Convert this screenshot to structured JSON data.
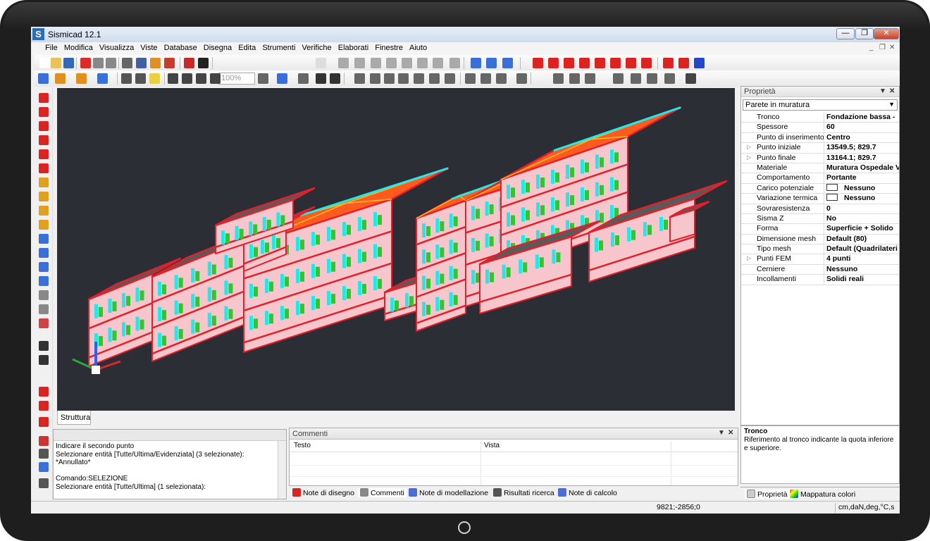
{
  "app": {
    "title": "Sismicad 12.1",
    "logo": "S",
    "win_controls": [
      "minimize-icon",
      "restore-icon",
      "close-icon"
    ]
  },
  "menu": [
    "File",
    "Modifica",
    "Visualizza",
    "Viste",
    "Database",
    "Disegna",
    "Edita",
    "Strumenti",
    "Verifiche",
    "Elaborati",
    "Finestre",
    "Aiuto"
  ],
  "toolbar": {
    "zoom_value": "100%"
  },
  "viewport": {
    "background": "#2b2e34",
    "roof_color": "#ff5a1f",
    "wall_color": "#f6c6cc",
    "edge_color": "#e0202a",
    "opening_color": "#22e8ea",
    "window_color": "#2ec82e"
  },
  "structure_tab": "Struttura",
  "command_log": [
    "Indicare il secondo punto",
    "Selezionare entità [Tutte/Ultima/Evidenziata] (3 selezionate):",
    "*Annullato*",
    "",
    "Comando:SELEZIONE",
    "Selezionare entità [Tutte/Ultima] (1 selezionata):"
  ],
  "comments": {
    "title": "Commenti",
    "columns": [
      "Testo",
      "Vista"
    ]
  },
  "bottom_tabs": [
    "Note di disegno",
    "Commenti",
    "Note di modellazione",
    "Risultati ricerca",
    "Note di calcolo"
  ],
  "properties": {
    "title": "Proprietà",
    "selected": "Parete in muratura",
    "rows": [
      {
        "k": "Tronco",
        "v": "Fondazione bassa -"
      },
      {
        "k": "Spessore",
        "v": "60"
      },
      {
        "k": "Punto di inserimento",
        "v": "Centro"
      },
      {
        "k": "Punto iniziale",
        "v": "13549.5; 829.7",
        "exp": true
      },
      {
        "k": "Punto finale",
        "v": "13164.1; 829.7",
        "exp": true
      },
      {
        "k": "Materiale",
        "v": "Muratura Ospedale V"
      },
      {
        "k": "Comportamento",
        "v": "Portante"
      },
      {
        "k": "Carico potenziale",
        "v": "Nessuno",
        "sw": true
      },
      {
        "k": "Variazione termica",
        "v": "Nessuno",
        "sw": true
      },
      {
        "k": "Sovraresistenza",
        "v": "0"
      },
      {
        "k": "Sisma Z",
        "v": "No"
      },
      {
        "k": "Forma",
        "v": "Superficie + Solido"
      },
      {
        "k": "Dimensione mesh",
        "v": "Default (80)"
      },
      {
        "k": "Tipo mesh",
        "v": "Default (Quadrilateri"
      },
      {
        "k": "Punti FEM",
        "v": "4 punti",
        "exp": true
      },
      {
        "k": "Cerniere",
        "v": "Nessuno"
      },
      {
        "k": "Incollamenti",
        "v": "Solidi reali"
      }
    ],
    "desc_title": "Tronco",
    "desc_text": "Riferimento al tronco indicante la quota inferiore e superiore.",
    "tabs": [
      "Proprietà",
      "Mappatura colori"
    ]
  },
  "status": {
    "coords": "9821;-2856;0",
    "units": "cm,daN,deg,°C,s"
  }
}
